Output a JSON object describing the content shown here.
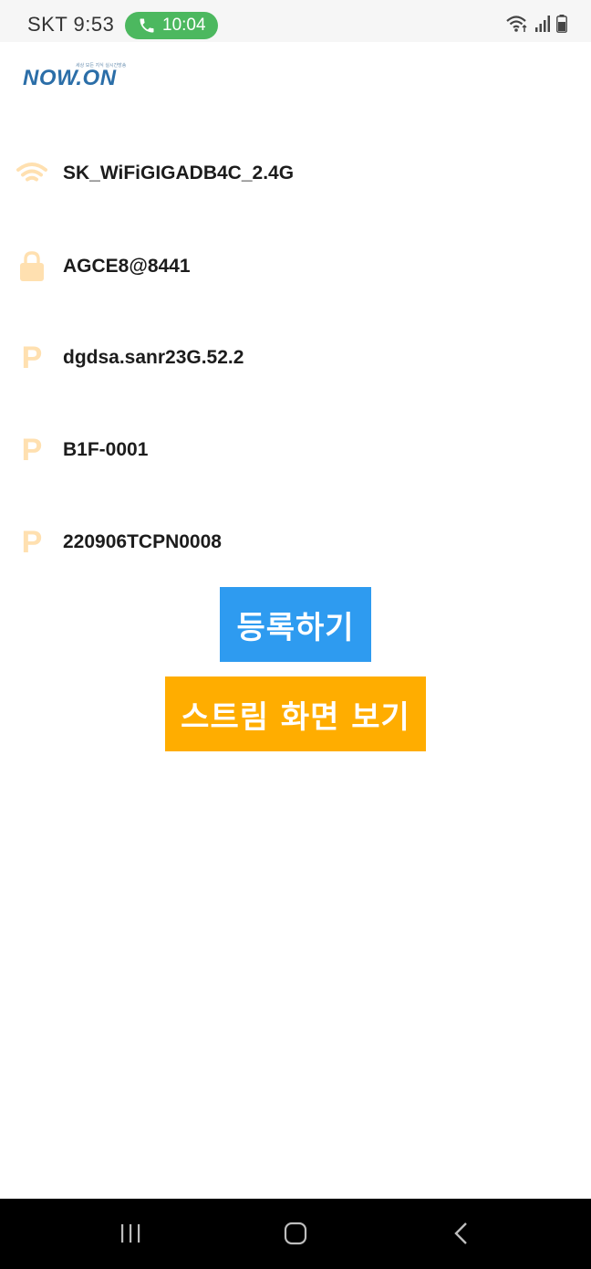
{
  "status_bar": {
    "carrier_time": "SKT 9:53",
    "call_time": "10:04",
    "call_pill_color": "#4cb85f",
    "icons": [
      "phone-icon",
      "wifi-icon",
      "signal-icon",
      "battery-icon"
    ]
  },
  "logo": {
    "text": "NOW.ON",
    "tagline": "세상 모든 지식 실시간방송",
    "color": "#2b6ea8"
  },
  "info_rows": [
    {
      "icon": "wifi-icon",
      "text": "SK_WiFiGIGADB4C_2.4G"
    },
    {
      "icon": "lock-icon",
      "text": "AGCE8@8441"
    },
    {
      "icon": "p-icon",
      "text": "dgdsa.sanr23G.52.2"
    },
    {
      "icon": "p-icon",
      "text": "B1F-0001"
    },
    {
      "icon": "p-icon",
      "text": "220906TCPN0008"
    }
  ],
  "icon_color": "#ffe0b0",
  "buttons": {
    "register_label": "등록하기",
    "register_color": "#2e9bf0",
    "stream_label": "스트림 화면 보기",
    "stream_color": "#ffad00"
  },
  "nav_bar": {
    "icons": [
      "recent-apps-icon",
      "home-icon",
      "back-icon"
    ]
  }
}
